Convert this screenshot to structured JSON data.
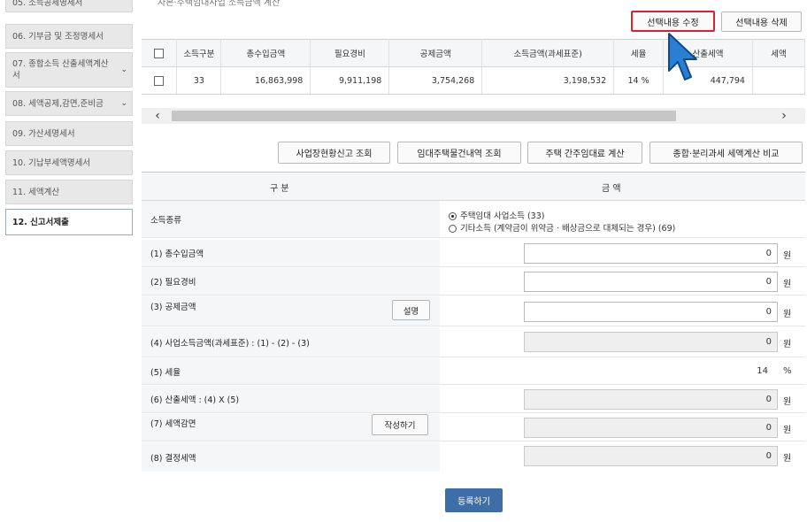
{
  "sidebar": {
    "items": [
      {
        "label": "05. 소득공제명세서",
        "active": false
      },
      {
        "label": "06. 기부금 및 조정명세서",
        "active": false
      },
      {
        "label": "07. 종합소득 산출세액계산서",
        "active": false,
        "has_chevron": true
      },
      {
        "label": "08. 세액공제,감면,준비금",
        "active": false,
        "has_chevron": true
      },
      {
        "label": "09. 가산세명세서",
        "active": false
      },
      {
        "label": "10. 기납부세액명세서",
        "active": false
      },
      {
        "label": "11. 세액계산",
        "active": false
      },
      {
        "label": "12. 신고서제출",
        "active": true
      }
    ]
  },
  "top_note": "자본·주택임대사업 소득금액 계산",
  "toolbar": {
    "edit_label": "선택내용 수정",
    "delete_label": "선택내용 삭제"
  },
  "grid": {
    "headers": [
      "소득구분",
      "총수입금액",
      "필요경비",
      "공제금액",
      "소득금액(과세표준)",
      "세율",
      "산출세액",
      "세액"
    ],
    "rows": [
      [
        "33",
        "16,863,998",
        "9,911,198",
        "3,754,268",
        "3,198,532",
        "14 %",
        "447,794",
        ""
      ]
    ]
  },
  "actions": {
    "biz_status": "사업장현황신고 조회",
    "rental_items": "임대주택물건내역 조회",
    "deemed_rent": "주택 간주임대료 계산",
    "compare": "종합·분리과세 세액계산 비교"
  },
  "form": {
    "col_category": "구    분",
    "col_amount": "금    액",
    "income_type_label": "소득종류",
    "option1": "주택임대 사업소득 (33)",
    "option2": "기타소득 (계약금이 위약금 · 배상금으로 대체되는 경우) (69)",
    "rows": [
      {
        "label": "(1) 총수입금액",
        "value": "0",
        "unit": "원"
      },
      {
        "label": "(2) 필요경비",
        "value": "0",
        "unit": "원"
      },
      {
        "label": "(3) 공제금액",
        "value": "0",
        "unit": "원",
        "button": "설명"
      },
      {
        "label": "(4) 사업소득금액(과세표준) : (1) - (2) - (3)",
        "value": "0",
        "unit": "원"
      },
      {
        "label": "(5) 세율",
        "value": "14",
        "unit": "%"
      },
      {
        "label": "(6) 산출세액 : (4) X (5)",
        "value": "0",
        "unit": "원"
      },
      {
        "label": "(7) 세액감면",
        "value": "0",
        "unit": "원",
        "button": "작성하기"
      },
      {
        "label": "(8) 결정세액",
        "value": "0",
        "unit": "원"
      }
    ]
  },
  "submit_label": "등록하기",
  "colors": {
    "highlight": "#e0202e",
    "submit": "#3e6ea8",
    "cursor": "#2a7fd4"
  }
}
